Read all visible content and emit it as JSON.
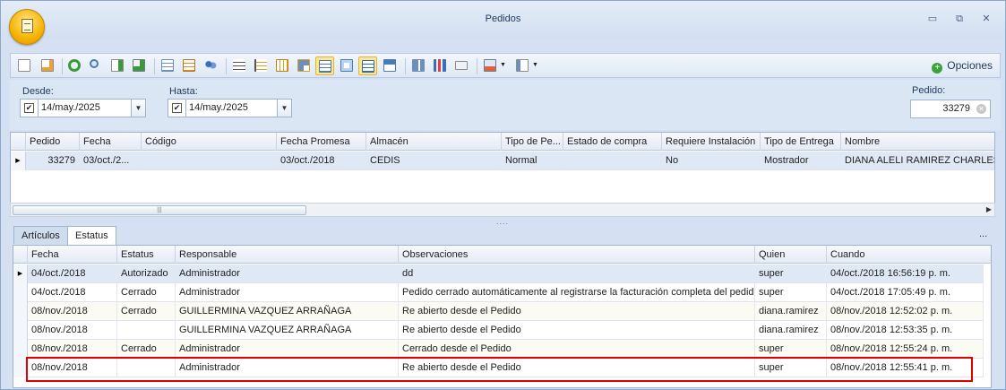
{
  "window": {
    "title": "Pedidos",
    "minimize": "▭",
    "restore": "⧉",
    "close": "✕"
  },
  "toolbar": {
    "icons": [
      "new-icon",
      "edit-icon",
      "refresh-icon",
      "search-icon",
      "export-icon",
      "send-icon",
      "grid-icon",
      "edit-table-icon",
      "people-icon",
      "align-icon",
      "sort-icon",
      "columns-icon",
      "layout-icon",
      "table-view-icon",
      "filter-icon",
      "table-view-2-icon",
      "layout-2-icon",
      "tiles-icon",
      "bar-chart-icon",
      "card-icon",
      "print-icon",
      "report-icon"
    ],
    "options_label": "Opciones"
  },
  "filters": {
    "desde_label": "Desde:",
    "desde_value": "14/may./2025",
    "desde_checked": "✔",
    "hasta_label": "Hasta:",
    "hasta_value": "14/may./2025",
    "hasta_checked": "✔",
    "pedido_label": "Pedido:",
    "pedido_value": "33279"
  },
  "orders_grid": {
    "columns": [
      "Pedido",
      "Fecha",
      "Código",
      "Fecha Promesa",
      "Almacén",
      "Tipo de Pe...",
      "Estado de compra",
      "Requiere Instalación",
      "Tipo de Entrega",
      "Nombre"
    ],
    "rows": [
      [
        "33279",
        "03/oct./2...",
        "",
        "03/oct./2018",
        "CEDIS",
        "Normal",
        "",
        "No",
        "Mostrador",
        "DIANA ALELI RAMIREZ CHARLES"
      ]
    ]
  },
  "scrollbar": {
    "thumb_grip": "|||",
    "splitter": "....",
    "arrow": "▶"
  },
  "tabs": [
    "Artículos",
    "Estatus"
  ],
  "tabs_more": "...",
  "status_grid": {
    "columns": [
      "Fecha",
      "Estatus",
      "Responsable",
      "Observaciones",
      "Quien",
      "Cuando"
    ],
    "rows": [
      [
        "04/oct./2018",
        "Autorizado",
        "Administrador",
        "dd",
        "super",
        "04/oct./2018 16:56:19 p. m."
      ],
      [
        "04/oct./2018",
        "Cerrado",
        "Administrador",
        "Pedido cerrado automáticamente al registrarse la facturación completa del pedido",
        "super",
        "04/oct./2018 17:05:49 p. m."
      ],
      [
        "08/nov./2018",
        "Cerrado",
        "GUILLERMINA VAZQUEZ ARRAÑAGA",
        "Re abierto desde el Pedido",
        "diana.ramirez",
        "08/nov./2018 12:52:02 p. m."
      ],
      [
        "08/nov./2018",
        "",
        "GUILLERMINA VAZQUEZ ARRAÑAGA",
        "Re abierto desde el Pedido",
        "diana.ramirez",
        "08/nov./2018 12:53:35 p. m."
      ],
      [
        "08/nov./2018",
        "Cerrado",
        "Administrador",
        "Cerrado desde el Pedido",
        "super",
        "08/nov./2018 12:55:24 p. m."
      ],
      [
        "08/nov./2018",
        "",
        "Administrador",
        "Re abierto desde el Pedido",
        "super",
        "08/nov./2018 12:55:41 p. m."
      ]
    ]
  },
  "row_indicator": "▶",
  "colors": {
    "highlight": "#e00000",
    "selected_row": "#dfe8f5",
    "accent": "#f5b400"
  }
}
